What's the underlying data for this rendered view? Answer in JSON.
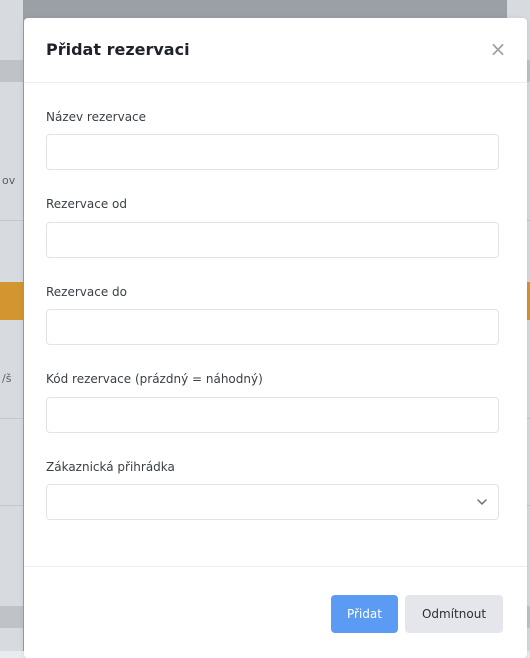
{
  "background": {
    "left_snippets": [
      "ov",
      "/š"
    ],
    "right_snippets": []
  },
  "modal": {
    "title": "Přidat rezervaci",
    "close_symbol": "×",
    "fields": [
      {
        "label": "Název rezervace",
        "value": "",
        "placeholder": ""
      },
      {
        "label": "Rezervace od",
        "value": "",
        "placeholder": ""
      },
      {
        "label": "Rezervace do",
        "value": "",
        "placeholder": ""
      },
      {
        "label": "Kód rezervace (prázdný = náhodný)",
        "value": "",
        "placeholder": ""
      }
    ],
    "select": {
      "label": "Zákaznická přihrádka",
      "selected": ""
    },
    "buttons": {
      "add": "Přidat",
      "dismiss": "Odmítnout"
    }
  },
  "colors": {
    "primary": "#5b9bf3",
    "secondary": "#e4e6ec",
    "accent_orange": "#d39530"
  },
  "icons": {
    "close": "close-icon",
    "select": "chevron-down-icon"
  }
}
